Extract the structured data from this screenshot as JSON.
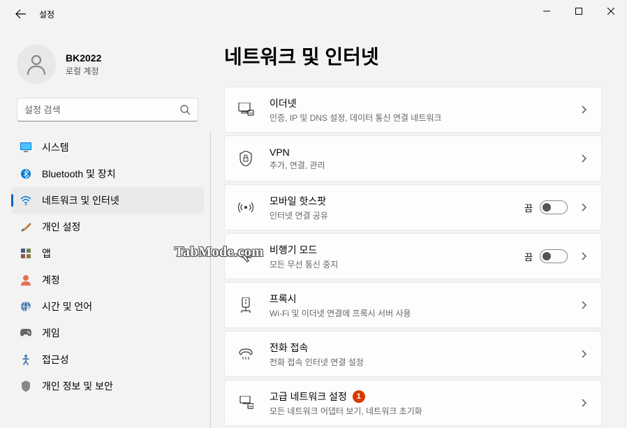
{
  "app": {
    "title": "설정"
  },
  "profile": {
    "name": "BK2022",
    "sub": "로컬 계정"
  },
  "search": {
    "placeholder": "설정 검색"
  },
  "nav": {
    "items": [
      {
        "label": "시스템"
      },
      {
        "label": "Bluetooth 및 장치"
      },
      {
        "label": "네트워크 및 인터넷"
      },
      {
        "label": "개인 설정"
      },
      {
        "label": "앱"
      },
      {
        "label": "계정"
      },
      {
        "label": "시간 및 언어"
      },
      {
        "label": "게임"
      },
      {
        "label": "접근성"
      },
      {
        "label": "개인 정보 및 보안"
      }
    ]
  },
  "page": {
    "title": "네트워크 및 인터넷"
  },
  "cards": [
    {
      "title": "이더넷",
      "sub": "인증, IP 및 DNS 설정, 데이터 통신 연결 네트워크"
    },
    {
      "title": "VPN",
      "sub": "추가, 연결, 관리"
    },
    {
      "title": "모바일 핫스팟",
      "sub": "인터넷 연결 공유",
      "toggle": "끔"
    },
    {
      "title": "비행기 모드",
      "sub": "모든 무선 통신 중지",
      "toggle": "끔"
    },
    {
      "title": "프록시",
      "sub": "Wi-Fi 및 이더넷 연결에 프록시 서버 사용"
    },
    {
      "title": "전화 접속",
      "sub": "전화 접속 인터넷 연결 설정"
    },
    {
      "title": "고급 네트워크 설정",
      "sub": "모든 네트워크 어댑터 보기, 네트워크 초기화",
      "badge": "1"
    }
  ],
  "watermark": "TabMode.com"
}
